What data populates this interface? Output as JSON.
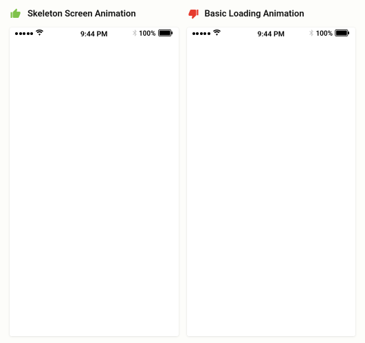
{
  "left": {
    "title": "Skeleton Screen Animation",
    "thumb_color": "#7fc24a",
    "status": {
      "time": "9:44 PM",
      "battery": "100%"
    }
  },
  "right": {
    "title": "Basic Loading Animation",
    "thumb_color": "#e63b2e",
    "status": {
      "time": "9:44 PM",
      "battery": "100%"
    }
  }
}
